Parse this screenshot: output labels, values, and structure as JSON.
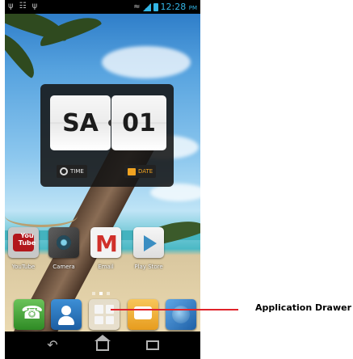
{
  "status_bar": {
    "left_icons": [
      "usb-icon",
      "android-debug-icon",
      "usb-icon"
    ],
    "right_icons": [
      "wifi-icon",
      "signal-icon",
      "battery-icon"
    ],
    "time": "12:28",
    "ampm": "PM"
  },
  "widget": {
    "day": "SA",
    "date": "01",
    "time_button": "TIME",
    "date_button": "DATE"
  },
  "apps": [
    {
      "label": "YouTube",
      "icon": "youtube-icon",
      "tile_text": "You Tube"
    },
    {
      "label": "Camera",
      "icon": "camera-icon"
    },
    {
      "label": "Email",
      "icon": "email-icon"
    },
    {
      "label": "Play Store",
      "icon": "play-store-icon"
    }
  ],
  "dock": [
    {
      "icon": "phone-icon"
    },
    {
      "icon": "contacts-icon"
    },
    {
      "icon": "app-drawer-icon"
    },
    {
      "icon": "messaging-icon"
    },
    {
      "icon": "browser-icon"
    }
  ],
  "nav": [
    "back-icon",
    "home-icon",
    "recents-icon"
  ],
  "callout": {
    "label": "Application Drawer",
    "color": "#e0232a"
  }
}
